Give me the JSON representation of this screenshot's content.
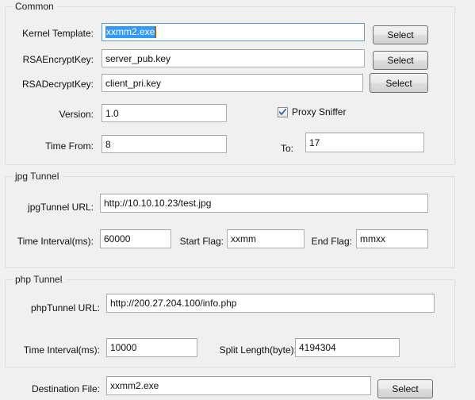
{
  "groups": {
    "common": {
      "title": "Common",
      "fields": {
        "kernel_template": {
          "label": "Kernel Template:",
          "value": "xxmm2.exe",
          "selected": true
        },
        "rsa_encrypt_key": {
          "label": "RSAEncryptKey:",
          "value": "server_pub.key"
        },
        "rsa_decrypt_key": {
          "label": "RSADecryptKey:",
          "value": "client_pri.key"
        },
        "version": {
          "label": "Version:",
          "value": "1.0"
        },
        "time_from": {
          "label": "Time From:",
          "value": "8"
        },
        "time_to": {
          "label": "To:",
          "value": "17"
        }
      },
      "checkbox": {
        "label": "Proxy Sniffer",
        "checked": true
      },
      "buttons": {
        "select_kernel": "Select",
        "select_encrypt": "Select",
        "select_decrypt": "Select"
      }
    },
    "jpg_tunnel": {
      "title": "jpg Tunnel",
      "fields": {
        "url": {
          "label": "jpgTunnel URL:",
          "value": "http://10.10.10.23/test.jpg"
        },
        "time_interval": {
          "label": "Time Interval(ms):",
          "value": "60000"
        },
        "start_flag": {
          "label": "Start Flag:",
          "value": "xxmm"
        },
        "end_flag": {
          "label": "End Flag:",
          "value": "mmxx"
        }
      }
    },
    "php_tunnel": {
      "title": "php Tunnel",
      "fields": {
        "url": {
          "label": "phpTunnel URL:",
          "value": "http://200.27.204.100/info.php"
        },
        "time_interval": {
          "label": "Time Interval(ms):",
          "value": "10000"
        },
        "split_length": {
          "label": "Split Length(byte):",
          "value": "4194304"
        }
      }
    }
  },
  "footer": {
    "destination_file": {
      "label": "Destination File:",
      "value": "xxmm2.exe"
    },
    "select_button": "Select"
  },
  "colors": {
    "window_bg": "#f0f0f0",
    "group_border": "#d8e0e6",
    "input_border": "#abadb3",
    "focus_border": "#5c9ccc",
    "selection_bg": "#3399ff",
    "caret": "#b45f06",
    "check_mark": "#1e5fa8"
  }
}
